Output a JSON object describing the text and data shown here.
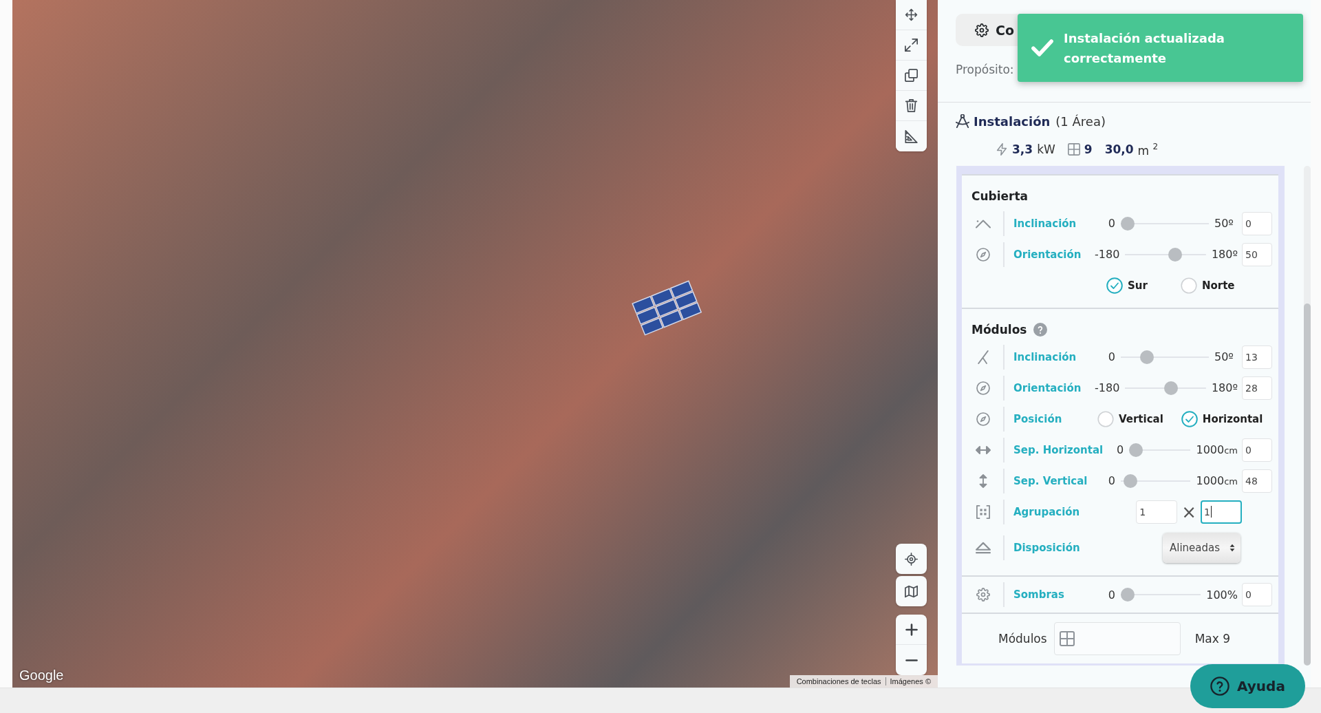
{
  "map": {
    "logo": "Google",
    "attribution": [
      "Combinaciones de teclas",
      "Imágenes ©"
    ]
  },
  "panel": {
    "tabs": [
      {
        "label": "Co",
        "selected": true
      }
    ],
    "purpose": {
      "label": "Propósito:"
    },
    "toast": {
      "message": "Instalación actualizada correctamente"
    },
    "installation": {
      "title": "Instalación",
      "subtitle": "(1 Área)",
      "stats": [
        {
          "kind": "power",
          "value": "3,3",
          "unit": "kW"
        },
        {
          "kind": "modules",
          "value": "9"
        },
        {
          "kind": "area",
          "value": "30,0",
          "unit": "m $^{2}$"
        }
      ]
    },
    "sections": [
      {
        "title": "Cubierta",
        "rows": [
          {
            "kind": "slider",
            "label": "Inclinación",
            "min": "0",
            "max": "50º",
            "level": 0,
            "value": "0"
          },
          {
            "kind": "slider",
            "label": "Orientación",
            "min": "-180",
            "max": "180º",
            "level": 0.64,
            "value": "50"
          },
          {
            "kind": "radio",
            "options": [
              {
                "label": "Sur",
                "selected": true
              },
              {
                "label": "Norte",
                "selected": false
              }
            ]
          }
        ]
      },
      {
        "title": "Módulos",
        "help": true,
        "rows": [
          {
            "kind": "slider",
            "label": "Inclinación",
            "min": "0",
            "max": "50º",
            "level": 0.26,
            "value": "13"
          },
          {
            "kind": "slider",
            "label": "Orientación",
            "min": "-180",
            "max": "180º",
            "level": 0.58,
            "value": "28"
          },
          {
            "kind": "radio",
            "label": "Posición",
            "options": [
              {
                "label": "Vertical",
                "selected": false
              },
              {
                "label": "Horizontal",
                "selected": true
              }
            ]
          },
          {
            "kind": "slider",
            "label": "Sep. Horizontal",
            "min": "0",
            "max": "1000",
            "unit": "cm",
            "level": 0,
            "value": "0"
          },
          {
            "kind": "slider",
            "label": "Sep. Vertical",
            "min": "0",
            "max": "1000",
            "unit": "cm",
            "level": 0.05,
            "value": "48"
          },
          {
            "kind": "pair",
            "label": "Agrupación",
            "separator": "×",
            "fields": [
              {
                "value": "1",
                "focused": false
              },
              {
                "value": "1",
                "focused": true
              }
            ]
          },
          {
            "kind": "select",
            "label": "Disposición",
            "value": "Alineadas"
          }
        ]
      },
      {
        "rows": [
          {
            "kind": "slider",
            "label": "Sombras",
            "min": "0",
            "max": "100%",
            "level": 0,
            "value": "0"
          }
        ]
      }
    ],
    "modules_field": {
      "label": "Módulos",
      "max": "Max 9"
    },
    "help_button": {
      "label": "Ayuda"
    }
  }
}
